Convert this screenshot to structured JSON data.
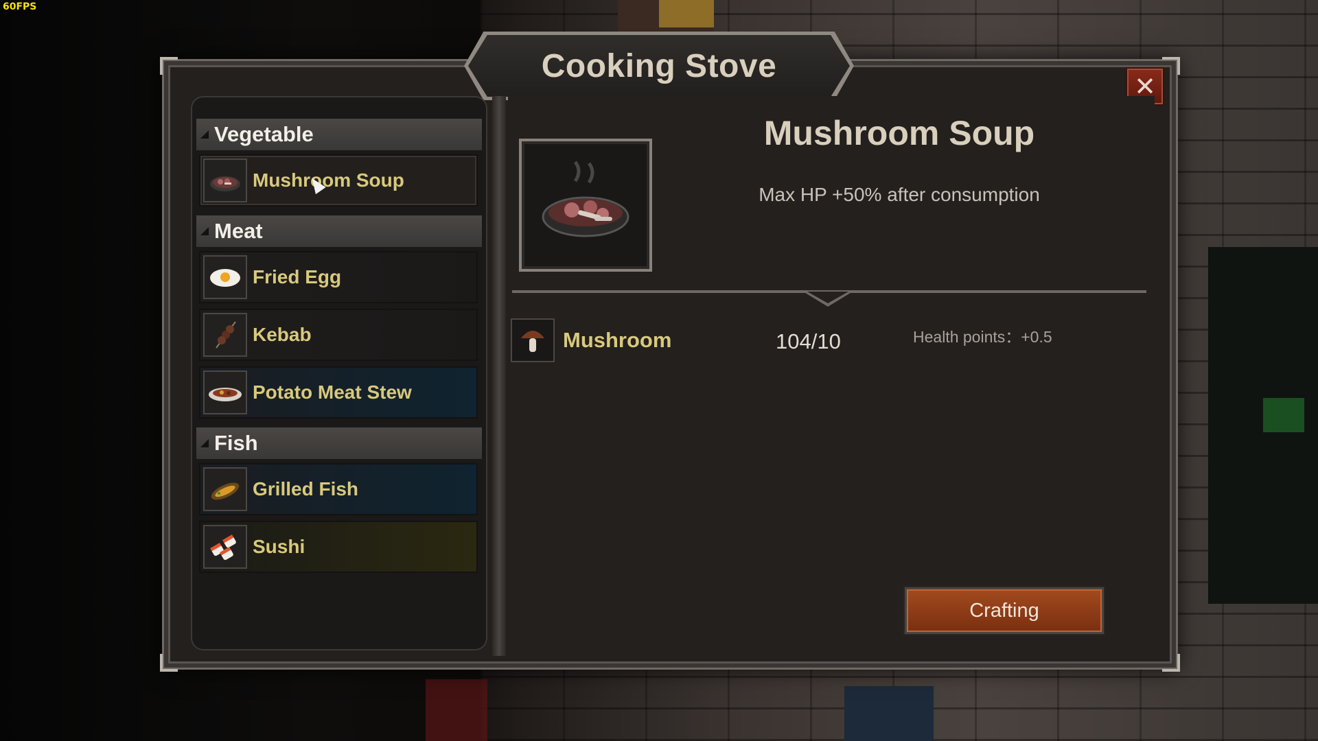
{
  "hud": {
    "fps": "60FPS"
  },
  "window": {
    "title": "Cooking Stove",
    "close_label": "✕"
  },
  "recipes": {
    "categories": [
      {
        "label": "Vegetable",
        "items": [
          {
            "name": "Mushroom Soup",
            "icon": "mushroom-soup-icon",
            "selected": true
          }
        ]
      },
      {
        "label": "Meat",
        "items": [
          {
            "name": "Fried Egg",
            "icon": "fried-egg-icon"
          },
          {
            "name": "Kebab",
            "icon": "kebab-icon"
          },
          {
            "name": "Potato Meat Stew",
            "icon": "potato-meat-stew-icon"
          }
        ]
      },
      {
        "label": "Fish",
        "items": [
          {
            "name": "Grilled Fish",
            "icon": "grilled-fish-icon"
          },
          {
            "name": "Sushi",
            "icon": "sushi-icon"
          }
        ]
      }
    ]
  },
  "detail": {
    "name": "Mushroom Soup",
    "description": "Max HP +50% after consumption",
    "ingredient": {
      "name": "Mushroom",
      "count": "104/10",
      "effect": "Health points：+0.5"
    },
    "craft_label": "Crafting"
  },
  "colors": {
    "accent_gold": "#d8c97c",
    "craft_button": "#a24a1e",
    "close_button": "#8a2a1a"
  }
}
